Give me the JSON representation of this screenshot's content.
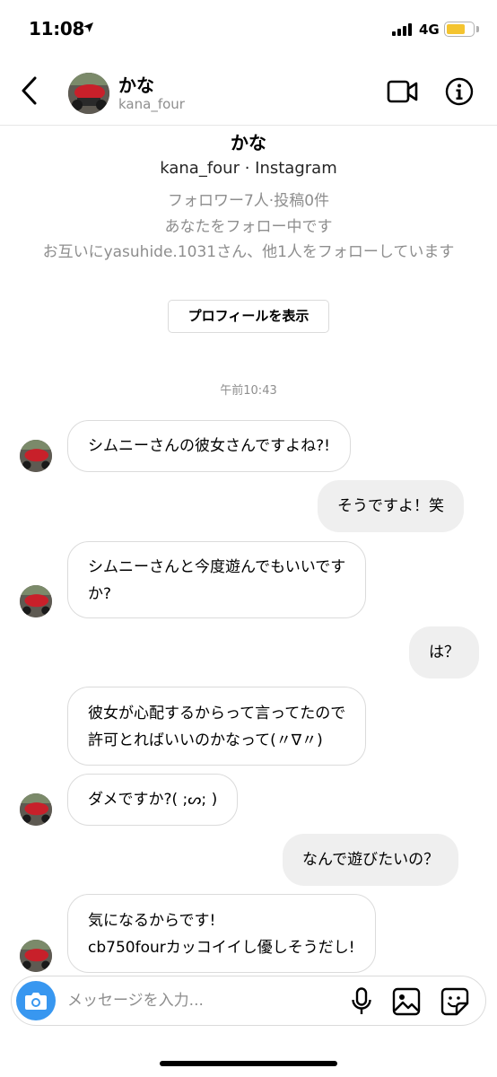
{
  "status_bar": {
    "time": "11:08",
    "network": "4G",
    "battery_color": "#f4c430",
    "battery_level": 0.75
  },
  "header": {
    "name": "かな",
    "username": "kana_four"
  },
  "profile": {
    "name": "かな",
    "handle": "kana_four · Instagram",
    "followers": "フォロワー7人·投稿0件",
    "follows_you": "あなたをフォロー中です",
    "mutual": "お互いにyasuhide.1031さん、他1人をフォローしています",
    "view_profile_label": "プロフィールを表示"
  },
  "timestamp": "午前10:43",
  "messages": [
    {
      "side": "received",
      "lines": [
        "シムニーさんの彼女さんですよね?!"
      ]
    },
    {
      "side": "sent",
      "lines": [
        "そうですよ！笑"
      ]
    },
    {
      "side": "received",
      "lines": [
        "シムニーさんと今度遊んでもいいです",
        "か?"
      ]
    },
    {
      "side": "sent",
      "lines": [
        "は？"
      ]
    },
    {
      "side": "received",
      "lines": [
        "彼女が心配するからって言ってたので",
        "許可とればいいのかなって(〃∇〃)"
      ]
    },
    {
      "side": "received",
      "lines": [
        "ダメですか?( ;ᔕ; )"
      ]
    },
    {
      "side": "sent",
      "lines": [
        "なんで遊びたいの？"
      ]
    },
    {
      "side": "received",
      "lines": [
        "気になるからです!",
        "cb750fourカッコイイし優しそうだし!"
      ]
    }
  ],
  "composer": {
    "placeholder": "メッセージを入力..."
  },
  "colors": {
    "accent": "#3897f0",
    "sent_bubble": "#efefef",
    "muted_text": "#8e8e8e"
  },
  "icons": [
    "back-icon",
    "video-call-icon",
    "info-icon",
    "camera-icon",
    "mic-icon",
    "gallery-icon",
    "sticker-icon"
  ]
}
